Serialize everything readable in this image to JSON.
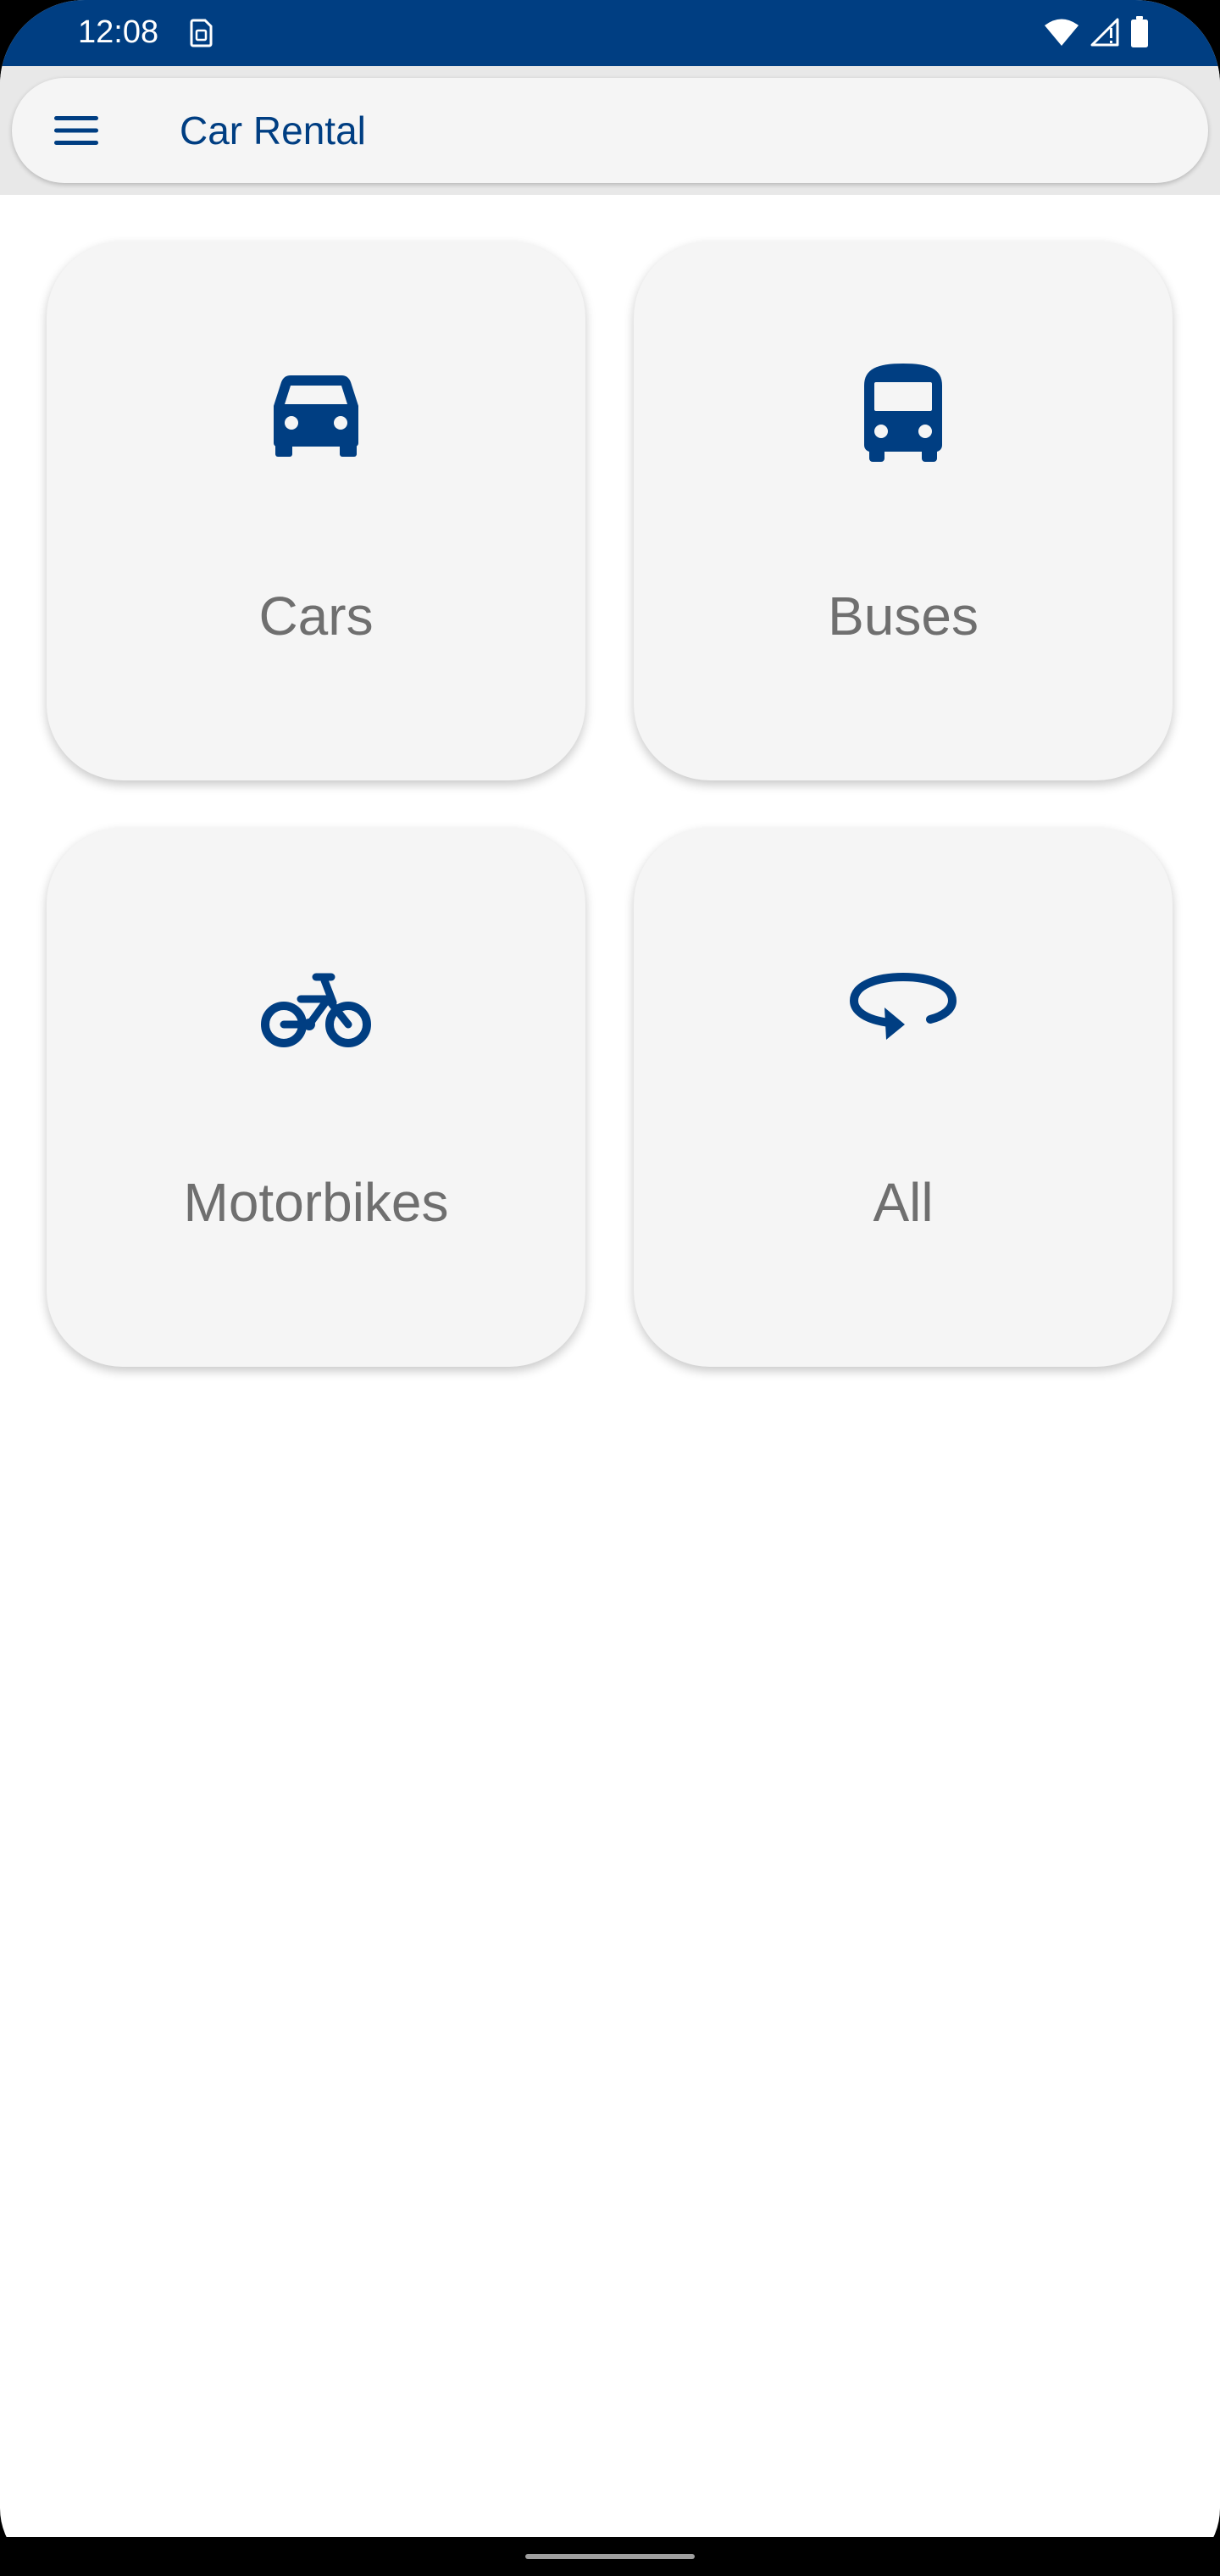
{
  "status_bar": {
    "time": "12:08",
    "icons": [
      "sim-card-icon",
      "wifi-icon",
      "signal-icon",
      "battery-icon"
    ]
  },
  "app_bar": {
    "menu_icon": "menu-icon",
    "title": "Car Rental"
  },
  "categories": [
    {
      "label": "Cars",
      "icon": "car-icon"
    },
    {
      "label": "Buses",
      "icon": "bus-icon"
    },
    {
      "label": "Motorbikes",
      "icon": "bicycle-icon"
    },
    {
      "label": "All",
      "icon": "rotate-arrow-icon"
    }
  ],
  "colors": {
    "brand": "#003e82",
    "card_bg": "#f5f5f5",
    "label_text": "#6f6f6f",
    "status_bar": "#003e82"
  }
}
